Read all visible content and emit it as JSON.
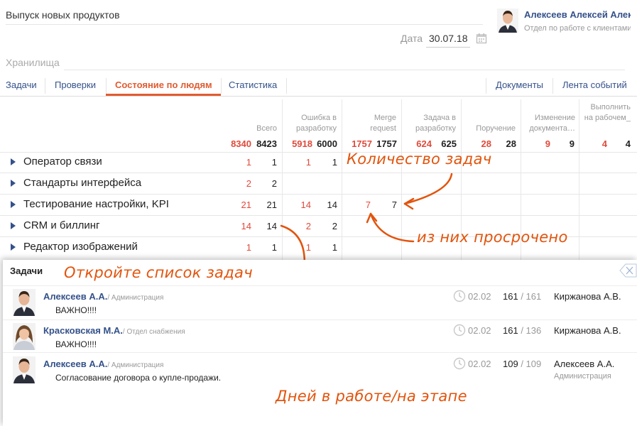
{
  "header": {
    "title": "Выпуск новых продуктов",
    "user_name": "Алексеев Алексей Алексеевич",
    "user_dept": "Отдел по работе с клиентами",
    "date_label": "Дата",
    "date_value": "30.07.18",
    "storage_label": "Хранилища"
  },
  "tabs": {
    "left": [
      "Задачи",
      "Проверки",
      "Состояние по людям",
      "Статистика"
    ],
    "right": [
      "Документы",
      "Лента событий"
    ],
    "active": "Состояние по людям"
  },
  "columns": [
    {
      "label": "Всего",
      "red_total": "8340",
      "total": "8423"
    },
    {
      "label": "Ошибка в разработку",
      "red_total": "5918",
      "total": "6000"
    },
    {
      "label": "Merge request",
      "red_total": "1757",
      "total": "1757"
    },
    {
      "label": "Задача в разработку",
      "red_total": "624",
      "total": "625"
    },
    {
      "label": "Поручение",
      "red_total": "28",
      "total": "28"
    },
    {
      "label": "Изменение документа…",
      "red_total": "9",
      "total": "9"
    },
    {
      "label": "Выполнить на рабочем_",
      "red_total": "4",
      "total": "4"
    }
  ],
  "rows": [
    {
      "name": "Оператор связи",
      "values": [
        [
          "1",
          "1"
        ],
        [
          "1",
          "1"
        ],
        null,
        null,
        null,
        null,
        null
      ]
    },
    {
      "name": "Стандарты интерфейса",
      "values": [
        [
          "2",
          "2"
        ],
        null,
        null,
        null,
        null,
        null,
        null
      ]
    },
    {
      "name": "Тестирование настройки, KPI",
      "values": [
        [
          "21",
          "21"
        ],
        [
          "14",
          "14"
        ],
        [
          "7",
          "7"
        ],
        null,
        null,
        null,
        null
      ]
    },
    {
      "name": "CRM и биллинг",
      "values": [
        [
          "14",
          "14"
        ],
        [
          "2",
          "2"
        ],
        null,
        null,
        null,
        null,
        null
      ]
    },
    {
      "name": "Редактор изображений",
      "values": [
        [
          "1",
          "1"
        ],
        [
          "1",
          "1"
        ],
        null,
        null,
        null,
        null,
        null
      ]
    }
  ],
  "annotations": {
    "task_count": "Количество задач",
    "overdue": "из них просрочено",
    "open_list": "Откройте список задач",
    "days": "Дней в работе/на этапе"
  },
  "panel": {
    "title": "Задачи",
    "tasks": [
      {
        "author": "Алексеев А.А.",
        "dept": "Администрация",
        "text": "ВАЖНО!!!!",
        "date": "02.02",
        "days_work": "161",
        "days_stage": "161",
        "executor": "Киржанова А.В.",
        "executor_dept": ""
      },
      {
        "author": "Красковская М.А.",
        "dept": "Отдел снабжения",
        "text": "ВАЖНО!!!!",
        "date": "02.02",
        "days_work": "161",
        "days_stage": "136",
        "executor": "Киржанова А.В.",
        "executor_dept": ""
      },
      {
        "author": "Алексеев А.А.",
        "dept": "Администрация",
        "text": "Согласование договора о купле-продажи.",
        "date": "02.02",
        "days_work": "109",
        "days_stage": "109",
        "executor": "Алексеев А.А.",
        "executor_dept": "Администрация"
      }
    ]
  },
  "colors": {
    "accent": "#e15b30",
    "link": "#34518a",
    "overdue": "#e04a3b",
    "annotation": "#e2540d"
  }
}
